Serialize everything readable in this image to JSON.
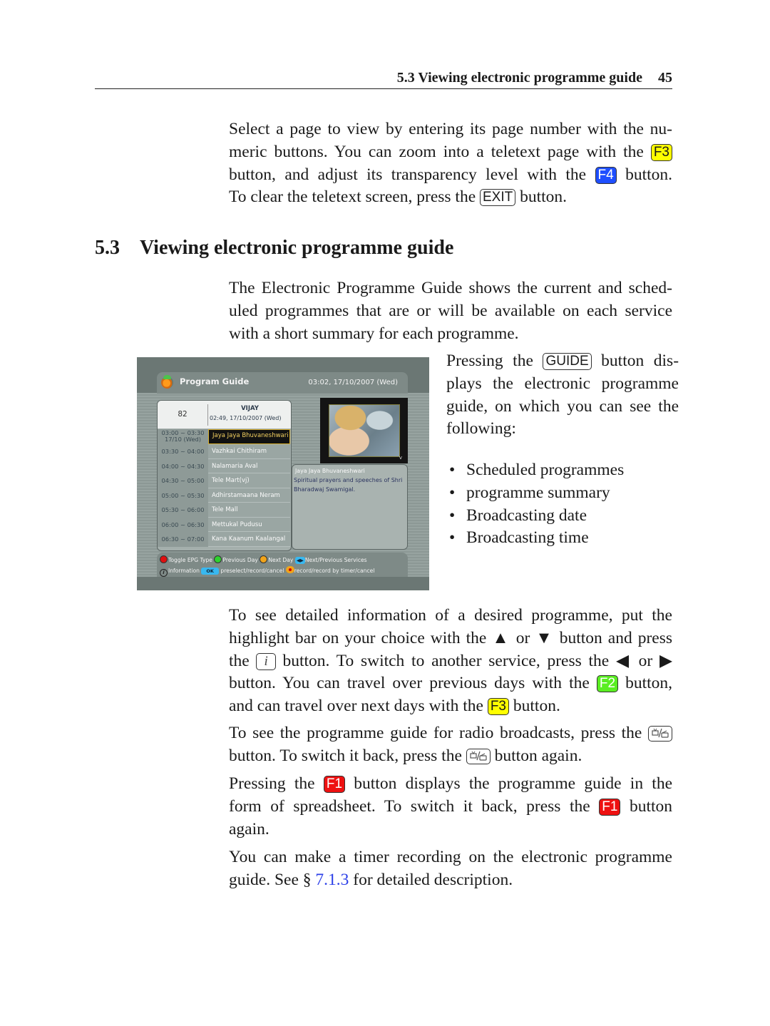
{
  "running_header": {
    "title": "5.3 Viewing electronic programme guide",
    "page_number": "45"
  },
  "intro_paragraph": {
    "l1": "Select a page to view by entering its page number with the nu-",
    "l2a": "meric buttons. You can zoom into a teletext page with the",
    "l2_key": "F3",
    "l3a": "button, and adjust its transparency level with the",
    "l3_key": "F4",
    "l3b": "button.",
    "l4a": "To clear the teletext screen, press the",
    "l4_key": "EXIT",
    "l4b": "button."
  },
  "section": {
    "number": "5.3",
    "title": "Viewing electronic programme guide"
  },
  "epg_intro": {
    "l1": "The Electronic Programme Guide shows the current and sched-",
    "l2": "uled programmes that are or will be available on each service",
    "l3": "with a short summary for each programme."
  },
  "guide_paragraph": {
    "l1a": "Pressing the",
    "l1_key": "GUIDE",
    "l1b": "button dis-",
    "l2": "plays the electronic programme",
    "l3": "guide, on which you can see the",
    "l4": "following:"
  },
  "bullets": [
    "Scheduled programmes",
    "programme summary",
    "Broadcasting date",
    "Broadcasting time"
  ],
  "epg_screen": {
    "title": "Program Guide",
    "clock": "03:02, 17/10/2007 (Wed)",
    "channel_number": "82",
    "channel_name": "VIJAY",
    "channel_datetime": "02:49, 17/10/2007 (Wed)",
    "rows": [
      {
        "time": "03:00 ~ 03:30",
        "date": "17/10 (Wed)",
        "title": "Jaya Jaya Bhuvaneshwari",
        "selected": true
      },
      {
        "time": "03:30 ~ 04:00",
        "title": "Vazhkai Chithiram"
      },
      {
        "time": "04:00 ~ 04:30",
        "title": "Nalamaria Aval"
      },
      {
        "time": "04:30 ~ 05:00",
        "title": "Tele Mart(vj)"
      },
      {
        "time": "05:00 ~ 05:30",
        "title": "Adhirstamaana Neram"
      },
      {
        "time": "05:30 ~ 06:00",
        "title": "Tele Mall"
      },
      {
        "time": "06:00 ~ 06:30",
        "title": "Mettukal Pudusu"
      },
      {
        "time": "06:30 ~ 07:00",
        "title": "Kana Kaanum Kaalangal"
      }
    ],
    "summary_title": "Jaya Jaya Bhuvaneshwari",
    "summary_text": "Spiritual prayers and speeches of Shri Bharadwaj Swamigal.",
    "legend": {
      "red": "Toggle EPG Type",
      "green": "Previous Day",
      "yellow": "Next Day",
      "lr_pill": "◀▶",
      "lr": "Next/Previous Services",
      "info": "Information",
      "ok_pill": "OK",
      "ok": "preselect/record/cancel",
      "rec": "record/record by timer/cancel"
    },
    "colors": {
      "red": "#e01010",
      "green": "#2fd12f",
      "yellow": "#f1a41a",
      "blue": "#38b8f0"
    }
  },
  "detail_paragraph": {
    "l1": "To see detailed information of a desired programme, put the",
    "l2a": "highlight bar on your choice with the",
    "l2_up": "▲",
    "l2_or": "or",
    "l2_down": "▼",
    "l2b": "button and press",
    "l3a": "the",
    "l3_key": "i",
    "l3b": "button. To switch to another service, press the",
    "l3_left": "◀",
    "l3_or": "or",
    "l3_right": "▶",
    "l4a": "button. You can travel over previous days with the",
    "l4_key": "F2",
    "l4b": "button,",
    "l5a": "and can travel over next days with the",
    "l5_key": "F3",
    "l5b": "button."
  },
  "radio_paragraph": {
    "l1a": "To see the programme guide for radio broadcasts, press the",
    "l2a": "button. To switch it back, press the",
    "l2b": "button again.",
    "key_icon": "tv-radio-icon"
  },
  "f1_paragraph": {
    "l1a": "Pressing the",
    "l1_key": "F1",
    "l1b": "button displays the programme guide in the",
    "l2a": "form of spreadsheet. To switch it back, press the",
    "l2_key": "F1",
    "l2b": "button",
    "l3": "again."
  },
  "timer_paragraph": {
    "l1": "You can make a timer recording on the electronic programme",
    "l2a": "guide. See §",
    "l2_link": "7.1.3",
    "l2b": "for detailed description.",
    "link_color": "#2a3ee8"
  }
}
